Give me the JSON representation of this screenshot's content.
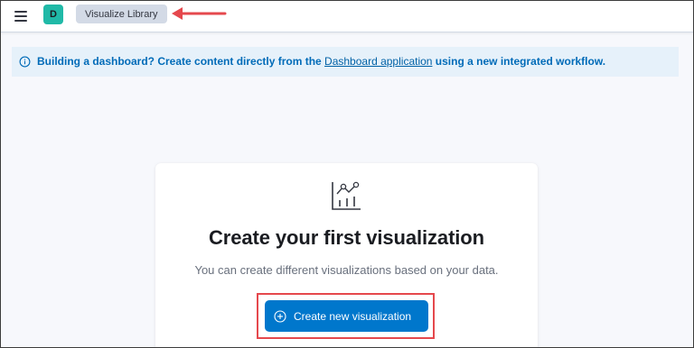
{
  "header": {
    "space_initial": "D",
    "breadcrumb": "Visualize Library"
  },
  "callout": {
    "text_before": "Building a dashboard? Create content directly from the ",
    "link_text": "Dashboard application",
    "text_after": " using a new integrated workflow."
  },
  "empty_state": {
    "title": "Create your first visualization",
    "body": "You can create different visualizations based on your data.",
    "button_label": "Create new visualization"
  },
  "colors": {
    "accent": "#0077cc",
    "avatar": "#20b9a7",
    "callout_bg": "#e6f1fa",
    "annotation_red": "#e5484d"
  },
  "icons": [
    "menu-icon",
    "info-icon",
    "visualization-icon",
    "plus-circle-icon",
    "red-arrow-annotation"
  ]
}
